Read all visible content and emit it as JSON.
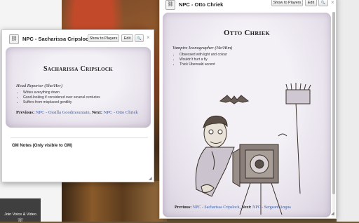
{
  "background": {
    "av_panel": {
      "label": "Join Voice & Video",
      "icon": "phone-icon"
    }
  },
  "dialog_left": {
    "title": "NPC - Sacharissa Cripslock",
    "buttons": {
      "show": "Show to Players",
      "edit": "Edit",
      "search": "🔍"
    },
    "close": "×",
    "card": {
      "name": "Sacharissa Cripslock",
      "role": "Head Reporter (She/Her)",
      "traits": [
        "Writes everything down",
        "Good-looking if considered over several centuries",
        "Suffers from misplaced gentility"
      ],
      "nav": {
        "prev_label": "Previous:",
        "prev_link": "NPC - Ossilla Goodmountain",
        "next_label": "Next:",
        "next_link": "NPC - Otto Chriek"
      }
    },
    "gm_notes": "GM Notes (Only visible to GM)"
  },
  "dialog_right": {
    "title": "NPC - Otto Chriek",
    "buttons": {
      "show": "Show to Players",
      "edit": "Edit",
      "search": "🔍"
    },
    "close": "×",
    "card": {
      "name": "Otto Chriek",
      "role": "Vampire Iconographer (He/Him)",
      "traits": [
        "Obsessed with light and colour",
        "Wouldn't hurt a fly",
        "Thick Überwald accent"
      ],
      "nav": {
        "prev_label": "Previous:",
        "prev_link": "NPC - Sacharissa Cripslock",
        "next_label": "Next:",
        "next_link": "NPC - Sergeant Angua"
      }
    }
  },
  "colors": {
    "link": "#3a5fa8",
    "parchment": "#ebe6ee"
  }
}
